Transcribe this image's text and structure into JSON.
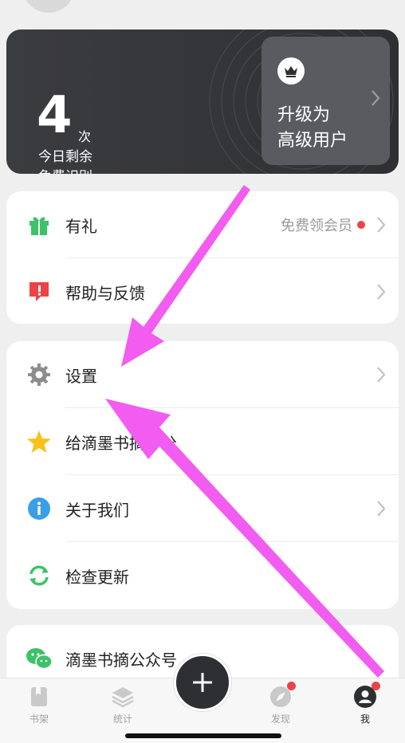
{
  "quota": {
    "count": "4",
    "unit": "次",
    "line1": "今日剩余",
    "line2": "免费识别",
    "upgrade_line1": "升级为",
    "upgrade_line2": "高级用户"
  },
  "menu_group1": [
    {
      "label": "有礼",
      "right_text": "免费领会员",
      "icon": "gift-icon"
    },
    {
      "label": "帮助与反馈",
      "icon": "help-feedback-icon"
    }
  ],
  "menu_group2": [
    {
      "label": "设置",
      "icon": "gear-icon"
    },
    {
      "label": "给滴墨书摘评分",
      "icon": "star-icon"
    },
    {
      "label": "关于我们",
      "icon": "info-icon"
    },
    {
      "label": "检查更新",
      "icon": "refresh-icon"
    }
  ],
  "menu_group3": [
    {
      "label": "滴墨书摘公众号",
      "icon": "wechat-icon"
    }
  ],
  "tabbar": {
    "tabs": [
      {
        "label": "书架",
        "icon": "bookshelf-icon"
      },
      {
        "label": "统计",
        "icon": "stats-layers-icon"
      },
      {
        "label": "发现",
        "icon": "compass-icon"
      },
      {
        "label": "我",
        "icon": "user-icon"
      }
    ],
    "add_icon": "plus-icon"
  },
  "colors": {
    "accent_green": "#3cc36a",
    "accent_red": "#ec4347",
    "accent_yellow": "#f7c21c",
    "accent_blue": "#3a9ee8",
    "annotation_magenta": "#f25cf0"
  }
}
